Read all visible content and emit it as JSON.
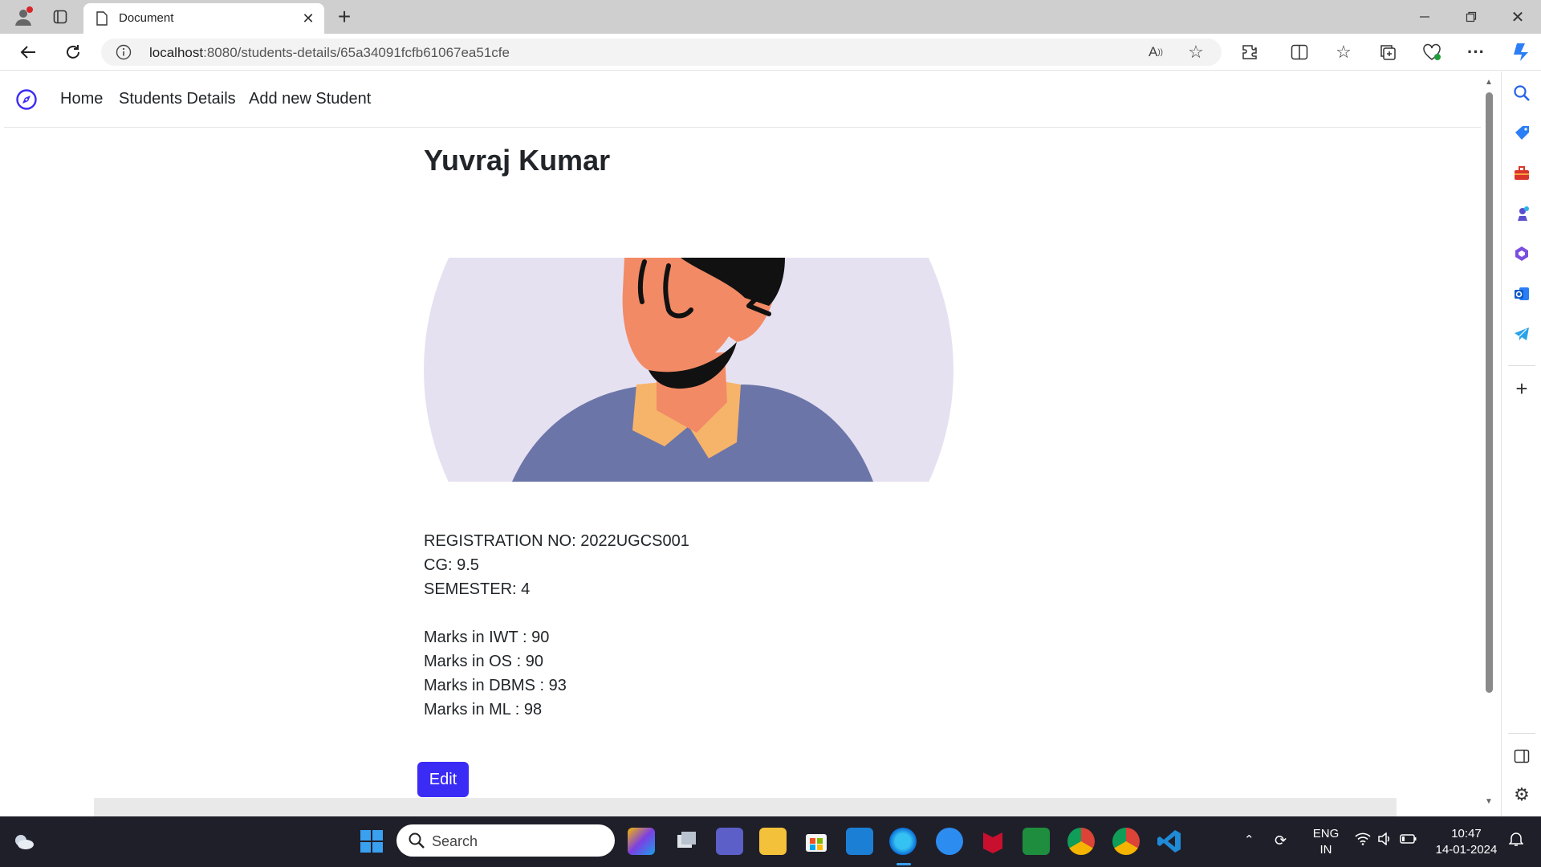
{
  "browser": {
    "tab_title": "Document",
    "url_host": "localhost",
    "url_path": ":8080/students-details/65a34091fcfb61067ea51cfe"
  },
  "navbar": {
    "links": [
      "Home",
      "Students Details",
      "Add new Student"
    ]
  },
  "student": {
    "name": "Yuvraj Kumar",
    "registration": "REGISTRATION NO: 2022UGCS001",
    "cg": "CG: 9.5",
    "semester": "SEMESTER: 4",
    "marks": [
      "Marks in IWT : 90",
      "Marks in OS : 90",
      "Marks in DBMS : 93",
      "Marks in ML : 98"
    ]
  },
  "edit_label": "Edit",
  "taskbar": {
    "search_label": "Search",
    "lang_line1": "ENG",
    "lang_line2": "IN",
    "time": "10:47",
    "date": "14-01-2024"
  },
  "colors": {
    "accent": "#3b2cf5",
    "avatar_bg": "#e6e1f1",
    "shirt": "#6b75a8",
    "skin": "#f28a66",
    "collar": "#f6b46a"
  },
  "icons": [
    "profile-icon",
    "tab-actions-icon",
    "page-icon",
    "close-icon",
    "new-tab-icon",
    "minimize-icon",
    "restore-icon",
    "window-close-icon",
    "back-icon",
    "refresh-icon",
    "info-icon",
    "read-aloud-icon",
    "favorite-icon",
    "extensions-icon",
    "split-screen-icon",
    "favorites-icon",
    "collections-icon",
    "performance-icon",
    "more-icon",
    "copilot-icon",
    "compass-icon",
    "search-icon",
    "shopping-icon",
    "tools-icon",
    "games-icon",
    "office-icon",
    "outlook-icon",
    "telegram-icon",
    "add-icon",
    "sidebar-toggle-icon",
    "settings-icon",
    "weather-icon",
    "windows-icon",
    "wifi-icon",
    "volume-icon",
    "battery-icon",
    "notification-icon"
  ]
}
